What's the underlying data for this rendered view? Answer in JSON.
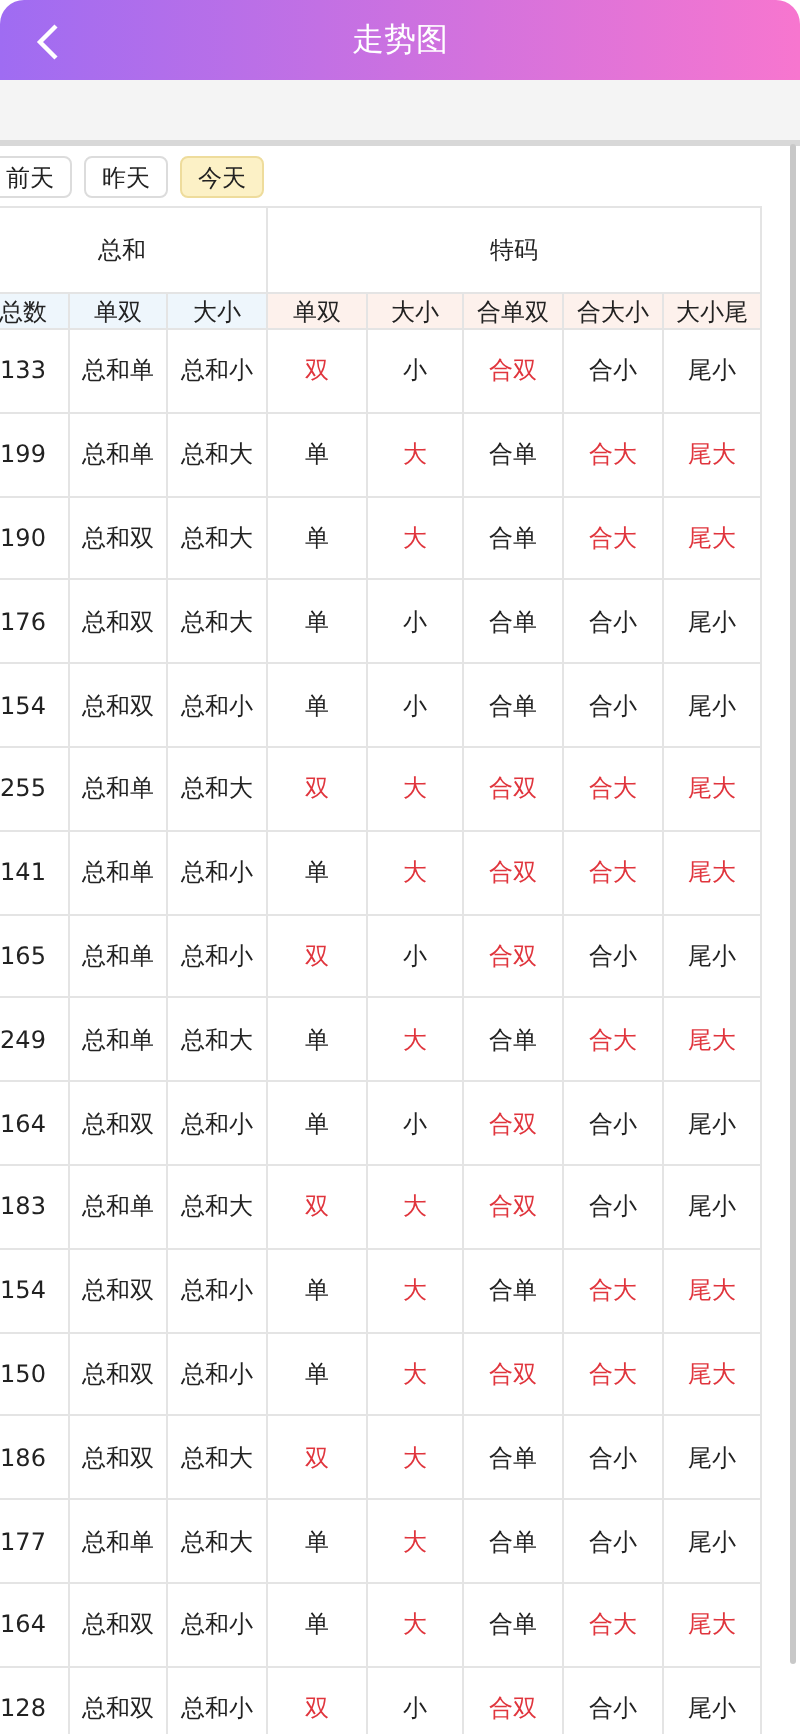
{
  "header": {
    "title": "走势图"
  },
  "day_tabs": [
    {
      "label": "前天",
      "selected": false
    },
    {
      "label": "昨天",
      "selected": false
    },
    {
      "label": "今天",
      "selected": true
    }
  ],
  "table": {
    "groups": [
      {
        "label": "总和",
        "kind": "sum",
        "columns": [
          "总数",
          "单双",
          "大小"
        ]
      },
      {
        "label": "特码",
        "kind": "special",
        "columns": [
          "单双",
          "大小",
          "合单双",
          "合大小",
          "大小尾"
        ]
      }
    ],
    "rows": [
      [
        {
          "text": "133",
          "highlighted": false
        },
        {
          "text": "总和单",
          "highlighted": false
        },
        {
          "text": "总和小",
          "highlighted": false
        },
        {
          "text": "双",
          "highlighted": true
        },
        {
          "text": "小",
          "highlighted": false
        },
        {
          "text": "合双",
          "highlighted": true
        },
        {
          "text": "合小",
          "highlighted": false
        },
        {
          "text": "尾小",
          "highlighted": false
        }
      ],
      [
        {
          "text": "199",
          "highlighted": false
        },
        {
          "text": "总和单",
          "highlighted": false
        },
        {
          "text": "总和大",
          "highlighted": false
        },
        {
          "text": "单",
          "highlighted": false
        },
        {
          "text": "大",
          "highlighted": true
        },
        {
          "text": "合单",
          "highlighted": false
        },
        {
          "text": "合大",
          "highlighted": true
        },
        {
          "text": "尾大",
          "highlighted": true
        }
      ],
      [
        {
          "text": "190",
          "highlighted": false
        },
        {
          "text": "总和双",
          "highlighted": false
        },
        {
          "text": "总和大",
          "highlighted": false
        },
        {
          "text": "单",
          "highlighted": false
        },
        {
          "text": "大",
          "highlighted": true
        },
        {
          "text": "合单",
          "highlighted": false
        },
        {
          "text": "合大",
          "highlighted": true
        },
        {
          "text": "尾大",
          "highlighted": true
        }
      ],
      [
        {
          "text": "176",
          "highlighted": false
        },
        {
          "text": "总和双",
          "highlighted": false
        },
        {
          "text": "总和大",
          "highlighted": false
        },
        {
          "text": "单",
          "highlighted": false
        },
        {
          "text": "小",
          "highlighted": false
        },
        {
          "text": "合单",
          "highlighted": false
        },
        {
          "text": "合小",
          "highlighted": false
        },
        {
          "text": "尾小",
          "highlighted": false
        }
      ],
      [
        {
          "text": "154",
          "highlighted": false
        },
        {
          "text": "总和双",
          "highlighted": false
        },
        {
          "text": "总和小",
          "highlighted": false
        },
        {
          "text": "单",
          "highlighted": false
        },
        {
          "text": "小",
          "highlighted": false
        },
        {
          "text": "合单",
          "highlighted": false
        },
        {
          "text": "合小",
          "highlighted": false
        },
        {
          "text": "尾小",
          "highlighted": false
        }
      ],
      [
        {
          "text": "255",
          "highlighted": false
        },
        {
          "text": "总和单",
          "highlighted": false
        },
        {
          "text": "总和大",
          "highlighted": false
        },
        {
          "text": "双",
          "highlighted": true
        },
        {
          "text": "大",
          "highlighted": true
        },
        {
          "text": "合双",
          "highlighted": true
        },
        {
          "text": "合大",
          "highlighted": true
        },
        {
          "text": "尾大",
          "highlighted": true
        }
      ],
      [
        {
          "text": "141",
          "highlighted": false
        },
        {
          "text": "总和单",
          "highlighted": false
        },
        {
          "text": "总和小",
          "highlighted": false
        },
        {
          "text": "单",
          "highlighted": false
        },
        {
          "text": "大",
          "highlighted": true
        },
        {
          "text": "合双",
          "highlighted": true
        },
        {
          "text": "合大",
          "highlighted": true
        },
        {
          "text": "尾大",
          "highlighted": true
        }
      ],
      [
        {
          "text": "165",
          "highlighted": false
        },
        {
          "text": "总和单",
          "highlighted": false
        },
        {
          "text": "总和小",
          "highlighted": false
        },
        {
          "text": "双",
          "highlighted": true
        },
        {
          "text": "小",
          "highlighted": false
        },
        {
          "text": "合双",
          "highlighted": true
        },
        {
          "text": "合小",
          "highlighted": false
        },
        {
          "text": "尾小",
          "highlighted": false
        }
      ],
      [
        {
          "text": "249",
          "highlighted": false
        },
        {
          "text": "总和单",
          "highlighted": false
        },
        {
          "text": "总和大",
          "highlighted": false
        },
        {
          "text": "单",
          "highlighted": false
        },
        {
          "text": "大",
          "highlighted": true
        },
        {
          "text": "合单",
          "highlighted": false
        },
        {
          "text": "合大",
          "highlighted": true
        },
        {
          "text": "尾大",
          "highlighted": true
        }
      ],
      [
        {
          "text": "164",
          "highlighted": false
        },
        {
          "text": "总和双",
          "highlighted": false
        },
        {
          "text": "总和小",
          "highlighted": false
        },
        {
          "text": "单",
          "highlighted": false
        },
        {
          "text": "小",
          "highlighted": false
        },
        {
          "text": "合双",
          "highlighted": true
        },
        {
          "text": "合小",
          "highlighted": false
        },
        {
          "text": "尾小",
          "highlighted": false
        }
      ],
      [
        {
          "text": "183",
          "highlighted": false
        },
        {
          "text": "总和单",
          "highlighted": false
        },
        {
          "text": "总和大",
          "highlighted": false
        },
        {
          "text": "双",
          "highlighted": true
        },
        {
          "text": "大",
          "highlighted": true
        },
        {
          "text": "合双",
          "highlighted": true
        },
        {
          "text": "合小",
          "highlighted": false
        },
        {
          "text": "尾小",
          "highlighted": false
        }
      ],
      [
        {
          "text": "154",
          "highlighted": false
        },
        {
          "text": "总和双",
          "highlighted": false
        },
        {
          "text": "总和小",
          "highlighted": false
        },
        {
          "text": "单",
          "highlighted": false
        },
        {
          "text": "大",
          "highlighted": true
        },
        {
          "text": "合单",
          "highlighted": false
        },
        {
          "text": "合大",
          "highlighted": true
        },
        {
          "text": "尾大",
          "highlighted": true
        }
      ],
      [
        {
          "text": "150",
          "highlighted": false
        },
        {
          "text": "总和双",
          "highlighted": false
        },
        {
          "text": "总和小",
          "highlighted": false
        },
        {
          "text": "单",
          "highlighted": false
        },
        {
          "text": "大",
          "highlighted": true
        },
        {
          "text": "合双",
          "highlighted": true
        },
        {
          "text": "合大",
          "highlighted": true
        },
        {
          "text": "尾大",
          "highlighted": true
        }
      ],
      [
        {
          "text": "186",
          "highlighted": false
        },
        {
          "text": "总和双",
          "highlighted": false
        },
        {
          "text": "总和大",
          "highlighted": false
        },
        {
          "text": "双",
          "highlighted": true
        },
        {
          "text": "大",
          "highlighted": true
        },
        {
          "text": "合单",
          "highlighted": false
        },
        {
          "text": "合小",
          "highlighted": false
        },
        {
          "text": "尾小",
          "highlighted": false
        }
      ],
      [
        {
          "text": "177",
          "highlighted": false
        },
        {
          "text": "总和单",
          "highlighted": false
        },
        {
          "text": "总和大",
          "highlighted": false
        },
        {
          "text": "单",
          "highlighted": false
        },
        {
          "text": "大",
          "highlighted": true
        },
        {
          "text": "合单",
          "highlighted": false
        },
        {
          "text": "合小",
          "highlighted": false
        },
        {
          "text": "尾小",
          "highlighted": false
        }
      ],
      [
        {
          "text": "164",
          "highlighted": false
        },
        {
          "text": "总和双",
          "highlighted": false
        },
        {
          "text": "总和小",
          "highlighted": false
        },
        {
          "text": "单",
          "highlighted": false
        },
        {
          "text": "大",
          "highlighted": true
        },
        {
          "text": "合单",
          "highlighted": false
        },
        {
          "text": "合大",
          "highlighted": true
        },
        {
          "text": "尾大",
          "highlighted": true
        }
      ],
      [
        {
          "text": "128",
          "highlighted": false
        },
        {
          "text": "总和双",
          "highlighted": false
        },
        {
          "text": "总和小",
          "highlighted": false
        },
        {
          "text": "双",
          "highlighted": true
        },
        {
          "text": "小",
          "highlighted": false
        },
        {
          "text": "合双",
          "highlighted": true
        },
        {
          "text": "合小",
          "highlighted": false
        },
        {
          "text": "尾小",
          "highlighted": false
        }
      ]
    ]
  }
}
